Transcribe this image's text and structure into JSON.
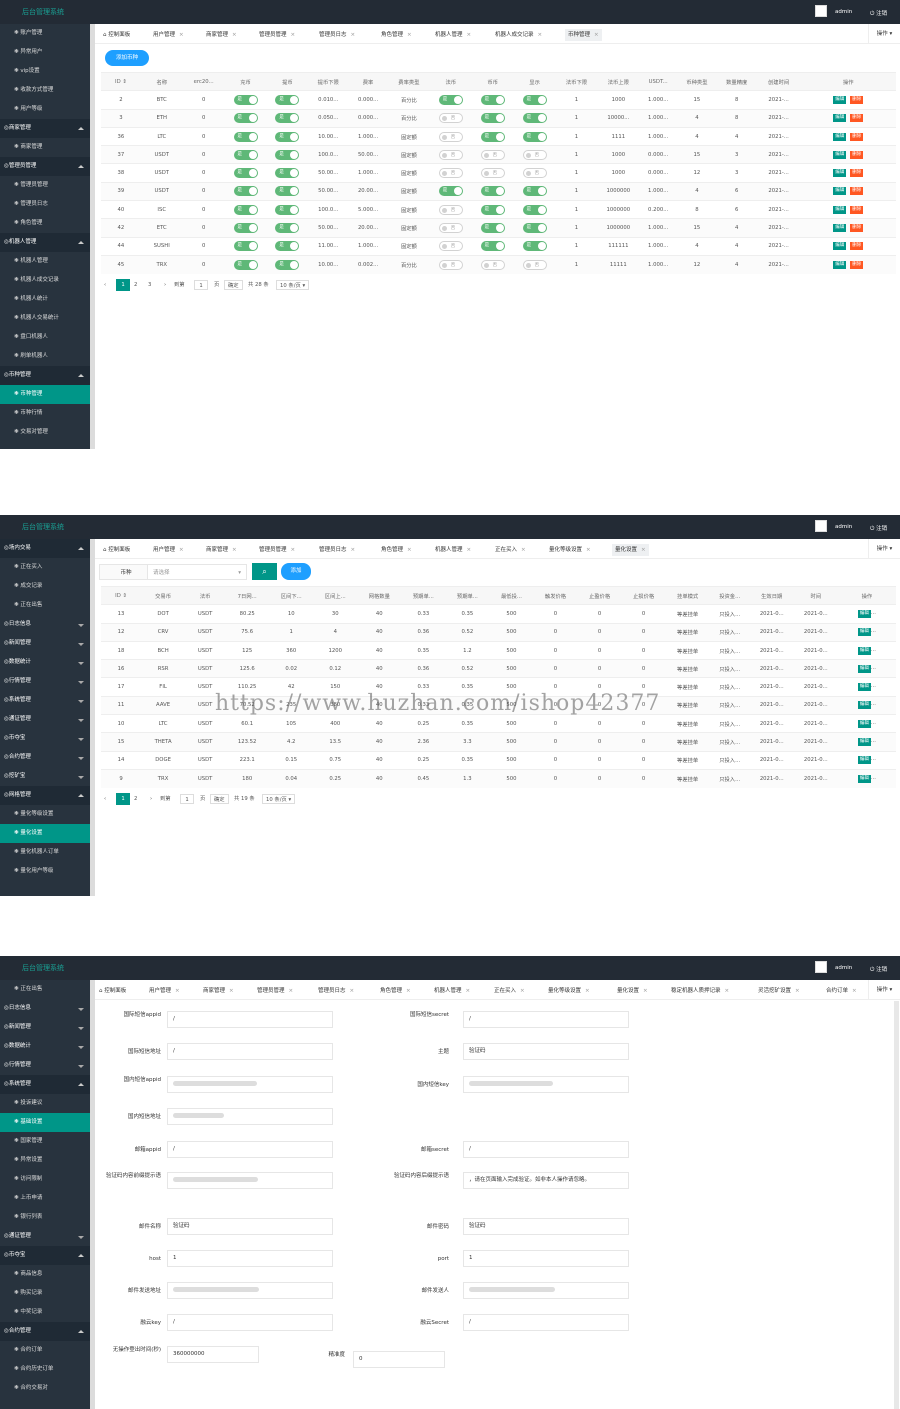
{
  "app": {
    "title": "后台管理系统",
    "user": "admin",
    "logout": "注销",
    "ops": "操作"
  },
  "shot1": {
    "sidebar": [
      {
        "label": "账户管理",
        "type": "item"
      },
      {
        "label": "异常用户",
        "type": "item"
      },
      {
        "label": "vip设置",
        "type": "item"
      },
      {
        "label": "收款方式管理",
        "type": "item"
      },
      {
        "label": "用户等级",
        "type": "item"
      },
      {
        "label": "商家管理",
        "type": "head"
      },
      {
        "label": "商家管理",
        "type": "item"
      },
      {
        "label": "管理员管理",
        "type": "head"
      },
      {
        "label": "管理员管理",
        "type": "item"
      },
      {
        "label": "管理员日志",
        "type": "item"
      },
      {
        "label": "角色管理",
        "type": "item"
      },
      {
        "label": "机器人管理",
        "type": "head"
      },
      {
        "label": "机器人管理",
        "type": "item"
      },
      {
        "label": "机器人成交记录",
        "type": "item"
      },
      {
        "label": "机器人统计",
        "type": "item"
      },
      {
        "label": "机器人交易统计",
        "type": "item"
      },
      {
        "label": "盘口机器人",
        "type": "item"
      },
      {
        "label": "刷单机器人",
        "type": "item"
      },
      {
        "label": "币种管理",
        "type": "head"
      },
      {
        "label": "币种管理",
        "type": "active"
      },
      {
        "label": "币种行情",
        "type": "item"
      },
      {
        "label": "交易对管理",
        "type": "item"
      }
    ],
    "tabs": [
      {
        "label": "控制面板",
        "home": true
      },
      {
        "label": "用户管理"
      },
      {
        "label": "商家管理"
      },
      {
        "label": "管理员管理"
      },
      {
        "label": "管理员日志"
      },
      {
        "label": "角色管理"
      },
      {
        "label": "机器人管理"
      },
      {
        "label": "机器人成交记录"
      },
      {
        "label": "币种管理",
        "active": true
      }
    ],
    "add_label": "添加币种",
    "columns": [
      "ID",
      "名称",
      "erc20...",
      "充币",
      "提币",
      "提币下限",
      "费率",
      "费率类型",
      "法币",
      "币币",
      "显示",
      "法币下限",
      "法币上限",
      "USDT...",
      "币种类型",
      "数量精度",
      "创建时间",
      "操作"
    ],
    "rows": [
      [
        "2",
        "BTC",
        "0",
        "on",
        "on",
        "0.010...",
        "0.000...",
        "百分比",
        "on",
        "on",
        "on",
        "1",
        "1000",
        "1.000...",
        "15",
        "8",
        "2021-..."
      ],
      [
        "3",
        "ETH",
        "0",
        "on",
        "on",
        "0.050...",
        "0.000...",
        "百分比",
        "off",
        "on",
        "on",
        "1",
        "10000...",
        "1.000...",
        "4",
        "8",
        "2021-..."
      ],
      [
        "36",
        "LTC",
        "0",
        "on",
        "on",
        "10.00...",
        "1.000...",
        "固定额",
        "off",
        "on",
        "on",
        "1",
        "1111",
        "1.000...",
        "4",
        "4",
        "2021-..."
      ],
      [
        "37",
        "USDT",
        "0",
        "on",
        "on",
        "100.0...",
        "50.00...",
        "固定额",
        "off",
        "off",
        "off",
        "1",
        "1000",
        "0.000...",
        "15",
        "3",
        "2021-..."
      ],
      [
        "38",
        "USDT",
        "0",
        "on",
        "on",
        "50.00...",
        "1.000...",
        "固定额",
        "off",
        "off",
        "off",
        "1",
        "1000",
        "0.000...",
        "12",
        "3",
        "2021-..."
      ],
      [
        "39",
        "USDT",
        "0",
        "on",
        "on",
        "50.00...",
        "20.00...",
        "固定额",
        "on",
        "on",
        "on",
        "1",
        "1000000",
        "1.000...",
        "4",
        "6",
        "2021-..."
      ],
      [
        "40",
        "ISC",
        "0",
        "on",
        "on",
        "100.0...",
        "5.000...",
        "固定额",
        "off",
        "on",
        "on",
        "1",
        "1000000",
        "0.200...",
        "8",
        "6",
        "2021-..."
      ],
      [
        "42",
        "ETC",
        "0",
        "on",
        "on",
        "50.00...",
        "20.00...",
        "固定额",
        "off",
        "on",
        "on",
        "1",
        "1000000",
        "1.000...",
        "15",
        "4",
        "2021-..."
      ],
      [
        "44",
        "SUSHI",
        "0",
        "on",
        "on",
        "11.00...",
        "1.000...",
        "固定额",
        "off",
        "on",
        "on",
        "1",
        "111111",
        "1.000...",
        "4",
        "4",
        "2021-..."
      ],
      [
        "45",
        "TRX",
        "0",
        "on",
        "on",
        "10.00...",
        "0.002...",
        "百分比",
        "off",
        "off",
        "off",
        "1",
        "11111",
        "1.000...",
        "12",
        "4",
        "2021-..."
      ]
    ],
    "switch_on": "是",
    "switch_off": "否",
    "edit": "编辑",
    "del": "删除",
    "pager": {
      "p1": "1",
      "p2": "2",
      "p3": "3",
      "goto": "到第",
      "page": "1",
      "unit": "页",
      "ok": "确定",
      "total": "共 28 条",
      "size": "10 条/页"
    }
  },
  "shot2": {
    "sidebar": [
      {
        "label": "场内交易",
        "type": "head"
      },
      {
        "label": "正在买入",
        "type": "item"
      },
      {
        "label": "成交记录",
        "type": "item"
      },
      {
        "label": "正在出售",
        "type": "item"
      },
      {
        "label": "日志信息",
        "type": "closed"
      },
      {
        "label": "新闻管理",
        "type": "closed"
      },
      {
        "label": "数据统计",
        "type": "closed"
      },
      {
        "label": "行情管理",
        "type": "closed"
      },
      {
        "label": "系统管理",
        "type": "closed"
      },
      {
        "label": "通证管理",
        "type": "closed"
      },
      {
        "label": "币夺宝",
        "type": "closed"
      },
      {
        "label": "合约管理",
        "type": "closed"
      },
      {
        "label": "挖矿宝",
        "type": "closed"
      },
      {
        "label": "网格管理",
        "type": "head"
      },
      {
        "label": "量化等级设置",
        "type": "item"
      },
      {
        "label": "量化设置",
        "type": "active"
      },
      {
        "label": "量化机器人订单",
        "type": "item"
      },
      {
        "label": "量化用户等级",
        "type": "item"
      }
    ],
    "tabs": [
      {
        "label": "控制面板",
        "home": true
      },
      {
        "label": "用户管理"
      },
      {
        "label": "商家管理"
      },
      {
        "label": "管理员管理"
      },
      {
        "label": "管理员日志"
      },
      {
        "label": "角色管理"
      },
      {
        "label": "机器人管理"
      },
      {
        "label": "正在买入"
      },
      {
        "label": "量化等级设置"
      },
      {
        "label": "量化设置",
        "active": true
      }
    ],
    "filter_label": "币种",
    "filter_placeholder": "请选择",
    "add_label": "添加",
    "columns": [
      "ID",
      "交易币",
      "法币",
      "7日网...",
      "区间下...",
      "区间上...",
      "网格数量",
      "预期单...",
      "预期单...",
      "最低投...",
      "触发价格",
      "止盈价格",
      "止损价格",
      "挂单模式",
      "投资金...",
      "生效日期",
      "时间",
      "操作"
    ],
    "rows": [
      [
        "13",
        "DOT",
        "USDT",
        "80.25",
        "10",
        "30",
        "40",
        "0.33",
        "0.35",
        "500",
        "0",
        "0",
        "0",
        "等差挂单",
        "只投入...",
        "2021-0...",
        "2021-0..."
      ],
      [
        "12",
        "CRV",
        "USDT",
        "75.6",
        "1",
        "4",
        "40",
        "0.36",
        "0.52",
        "500",
        "0",
        "0",
        "0",
        "等差挂单",
        "只投入...",
        "2021-0...",
        "2021-0..."
      ],
      [
        "18",
        "BCH",
        "USDT",
        "125",
        "360",
        "1200",
        "40",
        "0.35",
        "1.2",
        "500",
        "0",
        "0",
        "0",
        "等差挂单",
        "只投入...",
        "2021-0...",
        "2021-0..."
      ],
      [
        "16",
        "RSR",
        "USDT",
        "125.6",
        "0.02",
        "0.12",
        "40",
        "0.36",
        "0.52",
        "500",
        "0",
        "0",
        "0",
        "等差挂单",
        "只投入...",
        "2021-0...",
        "2021-0..."
      ],
      [
        "17",
        "FIL",
        "USDT",
        "110.25",
        "42",
        "150",
        "40",
        "0.33",
        "0.35",
        "500",
        "0",
        "0",
        "0",
        "等差挂单",
        "只投入...",
        "2021-0...",
        "2021-0..."
      ],
      [
        "11",
        "AAVE",
        "USDT",
        "70.52",
        "235",
        "380",
        "40",
        "0.33",
        "0.35",
        "500",
        "0",
        "0",
        "0",
        "等差挂单",
        "只投入...",
        "2021-0...",
        "2021-0..."
      ],
      [
        "10",
        "LTC",
        "USDT",
        "60.1",
        "105",
        "400",
        "40",
        "0.25",
        "0.35",
        "500",
        "0",
        "0",
        "0",
        "等差挂单",
        "只投入...",
        "2021-0...",
        "2021-0..."
      ],
      [
        "15",
        "THETA",
        "USDT",
        "123.52",
        "4.2",
        "13.5",
        "40",
        "2.36",
        "3.3",
        "500",
        "0",
        "0",
        "0",
        "等差挂单",
        "只投入...",
        "2021-0...",
        "2021-0..."
      ],
      [
        "14",
        "DOGE",
        "USDT",
        "223.1",
        "0.15",
        "0.75",
        "40",
        "0.25",
        "0.35",
        "500",
        "0",
        "0",
        "0",
        "等差挂单",
        "只投入...",
        "2021-0...",
        "2021-0..."
      ],
      [
        "9",
        "TRX",
        "USDT",
        "180",
        "0.04",
        "0.25",
        "40",
        "0.45",
        "1.3",
        "500",
        "0",
        "0",
        "0",
        "等差挂单",
        "只投入...",
        "2021-0...",
        "2021-0..."
      ]
    ],
    "edit": "编辑",
    "more": "...",
    "pager": {
      "p1": "1",
      "p2": "2",
      "goto": "到第",
      "page": "1",
      "unit": "页",
      "ok": "确定",
      "total": "共 19 条",
      "size": "10 条/页"
    }
  },
  "shot3": {
    "sidebar": [
      {
        "label": "正在出售",
        "type": "item"
      },
      {
        "label": "日志信息",
        "type": "closed"
      },
      {
        "label": "新闻管理",
        "type": "closed"
      },
      {
        "label": "数据统计",
        "type": "closed"
      },
      {
        "label": "行情管理",
        "type": "closed"
      },
      {
        "label": "系统管理",
        "type": "head"
      },
      {
        "label": "投诉建议",
        "type": "item"
      },
      {
        "label": "基础设置",
        "type": "active"
      },
      {
        "label": "国家管理",
        "type": "item"
      },
      {
        "label": "异常设置",
        "type": "item"
      },
      {
        "label": "访问限制",
        "type": "item"
      },
      {
        "label": "上币申请",
        "type": "item"
      },
      {
        "label": "银行列表",
        "type": "item"
      },
      {
        "label": "通证管理",
        "type": "closed"
      },
      {
        "label": "币夺宝",
        "type": "head"
      },
      {
        "label": "商品信息",
        "type": "item"
      },
      {
        "label": "购买记录",
        "type": "item"
      },
      {
        "label": "中奖记录",
        "type": "item"
      },
      {
        "label": "合约管理",
        "type": "head"
      },
      {
        "label": "合约订单",
        "type": "item"
      },
      {
        "label": "合约历史订单",
        "type": "item"
      },
      {
        "label": "合约交易对",
        "type": "item"
      }
    ],
    "tabs": [
      {
        "label": "控制面板",
        "home": true
      },
      {
        "label": "用户管理"
      },
      {
        "label": "商家管理"
      },
      {
        "label": "管理员管理"
      },
      {
        "label": "管理员日志"
      },
      {
        "label": "角色管理"
      },
      {
        "label": "机器人管理"
      },
      {
        "label": "正在买入"
      },
      {
        "label": "量化等级设置"
      },
      {
        "label": "量化设置"
      },
      {
        "label": "稳定机器人质押记录"
      },
      {
        "label": "灵活挖矿设置"
      },
      {
        "label": "合约订单"
      }
    ],
    "form_left": [
      {
        "label": "国际短信appid",
        "value": "/"
      },
      {
        "label": "国际短信地址",
        "value": "/"
      },
      {
        "label": "国内短信appid",
        "value": "",
        "blur": true
      },
      {
        "label": "国内短信地址",
        "value": "",
        "blur": true
      },
      {
        "label": "邮箱appid",
        "value": "/"
      },
      {
        "label": "验证码内容前缀提示语",
        "value": "",
        "blur": true
      },
      {
        "label": "邮件名称",
        "value": "验证码"
      },
      {
        "label": "host",
        "value": "1"
      },
      {
        "label": "邮件发送地址",
        "value": "",
        "blur": true
      },
      {
        "label": "融云key",
        "value": "/"
      },
      {
        "label": "无操作登出时间(秒)",
        "value": "360000000"
      }
    ],
    "form_right": [
      {
        "label": "国际短信secret",
        "value": "/"
      },
      {
        "label": "主题",
        "value": "验证码"
      },
      {
        "label": "国内短信key",
        "value": "",
        "blur": true
      },
      {
        "label": "",
        "value": "",
        "hidden": true
      },
      {
        "label": "邮箱secret",
        "value": "/"
      },
      {
        "label": "验证码内容后缀提示语",
        "value": "，请在页面输入完成验证。如非本人操作请忽略。"
      },
      {
        "label": "邮件密码",
        "value": "验证码"
      },
      {
        "label": "port",
        "value": "1"
      },
      {
        "label": "邮件发送人",
        "value": "",
        "blur": true
      },
      {
        "label": "融云Secret",
        "value": "/"
      },
      {
        "label": "精准度",
        "value": "0"
      }
    ]
  },
  "watermark": "https://www.huzhan.com/ishop42377",
  "colors": {
    "accent": "#009688",
    "topbar": "#232b35",
    "sidebar": "#28333e",
    "switch_on": "#5fb878",
    "btn_blue": "#1e9fff",
    "btn_del": "#ff5722"
  }
}
